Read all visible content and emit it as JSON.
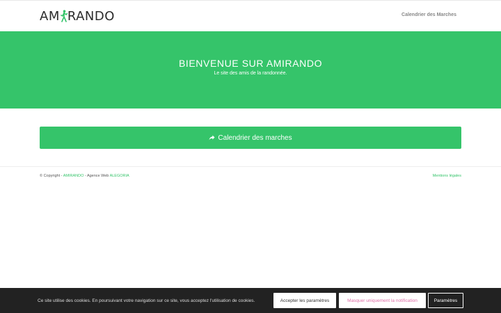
{
  "header": {
    "logo_left": "AM",
    "logo_right": "RANDO",
    "nav_link": "Calendrier des Marches"
  },
  "hero": {
    "title": "BIENVENUE SUR AMIRANDO",
    "subtitle": "Le site des amis de la randonnée."
  },
  "cta": {
    "label": "Calendrier des marches"
  },
  "footer": {
    "copyright_prefix": "© Copyright - ",
    "site_link": "AMIRANDO",
    "agency_prefix": " - Agence Web ",
    "agency_link": "ALEGORIA",
    "legal": "Mentions légales"
  },
  "cookie": {
    "text": "Ce site utilise des cookies. En poursuivant votre navigation sur ce site, vous acceptez l'utilisation de cookies.",
    "accept": "Accepter les paramètres",
    "hide": "Masquer uniquement la notification",
    "settings": "Paramètres"
  },
  "colors": {
    "accent": "#35c46a",
    "cookie_bg": "#222222",
    "hide_text": "#e06fa8"
  },
  "icons": {
    "logo": "hiker-icon",
    "cta": "share-arrow-icon"
  }
}
